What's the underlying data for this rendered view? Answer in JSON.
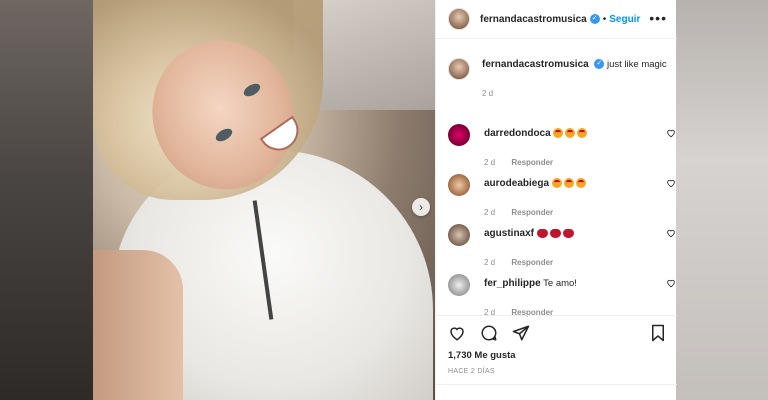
{
  "post": {
    "username": "fernandacastromusica",
    "follow_label": "Seguir",
    "separator": "•",
    "caption": "just like magic",
    "caption_time": "2 d"
  },
  "comments": [
    {
      "username": "darredondoca",
      "text": "",
      "emoji_count": 3,
      "emoji": "heart-eyes",
      "time": "2 d",
      "reply": "Responder"
    },
    {
      "username": "aurodeabiega",
      "text": "",
      "emoji_count": 3,
      "emoji": "heart-eyes",
      "time": "2 d",
      "reply": "Responder"
    },
    {
      "username": "agustinaxf",
      "text": "",
      "emoji_count": 3,
      "emoji": "red-heart",
      "time": "2 d",
      "reply": "Responder"
    },
    {
      "username": "fer_philippe",
      "text": "Te amo!",
      "emoji_count": 0,
      "emoji": "",
      "time": "2 d",
      "reply": "Responder"
    }
  ],
  "stats": {
    "likes": "1,730 Me gusta",
    "posted_ago": "HACE 2 DÍAS"
  },
  "colors": {
    "accent": "#0095f6",
    "verified": "#3897f0",
    "text": "#262626",
    "muted": "#8e8e8e"
  }
}
